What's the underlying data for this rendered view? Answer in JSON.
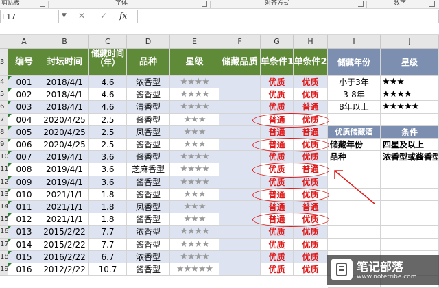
{
  "ribbon": {
    "clipboard": "剪贴板",
    "font": "字体",
    "align": "对齐方式",
    "number": "数字"
  },
  "formula_bar": {
    "name_box": "L17",
    "fx": "fx",
    "cancel": "✕",
    "confirm": "✓"
  },
  "columns": [
    "A",
    "B",
    "C",
    "D",
    "E",
    "F",
    "G",
    "H",
    "I",
    "J"
  ],
  "row_numbers": [
    "3",
    "4",
    "5",
    "6",
    "7",
    "8",
    "9",
    "10",
    "11",
    "12",
    "13",
    "14",
    "15",
    "16",
    "17",
    "18",
    "19"
  ],
  "headers": [
    "编号",
    "封坛时间",
    "储藏时间（年）",
    "品种",
    "星级",
    "储藏品质",
    "单条件1",
    "单条件2"
  ],
  "rows": [
    {
      "id": "001",
      "date": "2018/4/1",
      "years": "4.6",
      "type": "浓香型",
      "stars": "★★★★",
      "c1": "优质",
      "c2": "优质"
    },
    {
      "id": "002",
      "date": "2018/4/1",
      "years": "4.6",
      "type": "酱香型",
      "stars": "★★★★",
      "c1": "优质",
      "c2": "优质"
    },
    {
      "id": "003",
      "date": "2018/4/1",
      "years": "4.6",
      "type": "清香型",
      "stars": "★★★★",
      "c1": "优质",
      "c2": "普通"
    },
    {
      "id": "004",
      "date": "2020/4/25",
      "years": "2.5",
      "type": "酱香型",
      "stars": "★★★",
      "c1": "普通",
      "c2": "优质"
    },
    {
      "id": "005",
      "date": "2020/4/25",
      "years": "2.5",
      "type": "凤香型",
      "stars": "★★★",
      "c1": "普通",
      "c2": "普通"
    },
    {
      "id": "006",
      "date": "2020/4/25",
      "years": "2.5",
      "type": "酱香型",
      "stars": "★★★",
      "c1": "普通",
      "c2": "优质"
    },
    {
      "id": "007",
      "date": "2019/4/1",
      "years": "3.6",
      "type": "酱香型",
      "stars": "★★★★",
      "c1": "优质",
      "c2": "优质"
    },
    {
      "id": "008",
      "date": "2019/4/1",
      "years": "3.6",
      "type": "芝麻香型",
      "stars": "★★★★",
      "c1": "优质",
      "c2": "普通"
    },
    {
      "id": "009",
      "date": "2019/4/1",
      "years": "3.6",
      "type": "酱香型",
      "stars": "★★★★",
      "c1": "优质",
      "c2": "优质"
    },
    {
      "id": "010",
      "date": "2021/1/1",
      "years": "1.8",
      "type": "酱香型",
      "stars": "★★★",
      "c1": "普通",
      "c2": "优质"
    },
    {
      "id": "011",
      "date": "2021/1/1",
      "years": "1.8",
      "type": "凤香型",
      "stars": "★★★",
      "c1": "普通",
      "c2": "普通"
    },
    {
      "id": "012",
      "date": "2021/1/1",
      "years": "1.8",
      "type": "酱香型",
      "stars": "★★★",
      "c1": "普通",
      "c2": "优质"
    },
    {
      "id": "013",
      "date": "2015/2/22",
      "years": "7.7",
      "type": "浓香型",
      "stars": "★★★★",
      "c1": "优质",
      "c2": "优质"
    },
    {
      "id": "014",
      "date": "2015/2/22",
      "years": "7.7",
      "type": "酱香型",
      "stars": "★★★★",
      "c1": "优质",
      "c2": "优质"
    },
    {
      "id": "015",
      "date": "2016/2/22",
      "years": "6.7",
      "type": "浓香型",
      "stars": "★★★★",
      "c1": "优质",
      "c2": "优质"
    },
    {
      "id": "016",
      "date": "2012/2/22",
      "years": "10.7",
      "type": "酱香型",
      "stars": "★★★★★",
      "c1": "优质",
      "c2": "优质"
    }
  ],
  "legend": {
    "header": [
      "储藏年份",
      "星级"
    ],
    "rows": [
      [
        "小于3年",
        "★★★"
      ],
      [
        "3-8年",
        "★★★★"
      ],
      [
        "8年以上",
        "★★★★★"
      ]
    ]
  },
  "conditions": {
    "header": [
      "优质储藏酒",
      "条件"
    ],
    "rows": [
      [
        "储藏年份",
        "四星及以上"
      ],
      [
        "品种",
        "浓香型或酱香型"
      ]
    ]
  },
  "watermark": {
    "title": "笔记部落",
    "url": "www.notetribe.com"
  },
  "colors": {
    "header_green": "#5f8a38",
    "header_blue": "#7d8fb0",
    "band": "#dde3f0",
    "highlight_red": "#e01b1b"
  }
}
